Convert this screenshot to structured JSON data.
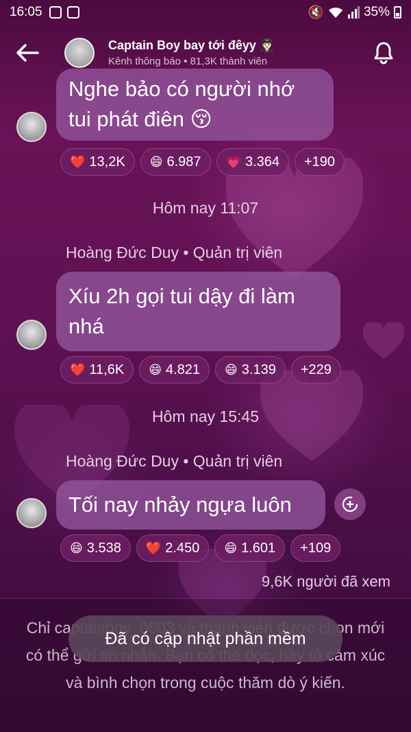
{
  "status_bar": {
    "time": "16:05",
    "battery": "35%"
  },
  "header": {
    "back_icon": "arrow-left-icon",
    "title": "Captain Boy bay tới đêyy 🧑🏻‍✈️",
    "subtitle": "Kênh thông báo • 81,3K thành viên",
    "bell_icon": "bell-icon"
  },
  "messages": [
    {
      "bubble_text": "Nghe bảo có người nhớ tui phát điên 😚",
      "reactions": [
        {
          "emoji": "❤️",
          "count": "13,2K"
        },
        {
          "emoji": "😄",
          "count": "6.987"
        },
        {
          "emoji": "💗",
          "count": "3.364"
        },
        {
          "emoji": "",
          "count": "+190"
        }
      ]
    },
    {
      "date": "Hôm nay 11:07",
      "sender": "Hoàng Đức Duy • Quản trị viên",
      "bubble_text": "Xíu 2h gọi tui dậy đi làm nhá",
      "reactions": [
        {
          "emoji": "❤️",
          "count": "11,6K"
        },
        {
          "emoji": "😄",
          "count": "4.821"
        },
        {
          "emoji": "😄",
          "count": "3.139"
        },
        {
          "emoji": "",
          "count": "+229"
        }
      ]
    },
    {
      "date": "Hôm nay 15:45",
      "sender": "Hoàng Đức Duy • Quản trị viên",
      "bubble_text": "Tối nay nhảy ngựa luôn",
      "reactions": [
        {
          "emoji": "😄",
          "count": "3.538"
        },
        {
          "emoji": "❤️",
          "count": "2.450"
        },
        {
          "emoji": "😄",
          "count": "1.601"
        },
        {
          "emoji": "",
          "count": "+109"
        }
      ],
      "views": "9,6K người đã xem"
    }
  ],
  "footer": {
    "info": "Chỉ captainboy_0603 và thành viên được chọn mới có thể gửi tin nhắn. Bạn có thể đọc, bày tỏ cảm xúc và bình chọn trong cuộc thăm dò ý kiến."
  },
  "toast": {
    "text": "Đã có cập nhật phần mềm"
  }
}
